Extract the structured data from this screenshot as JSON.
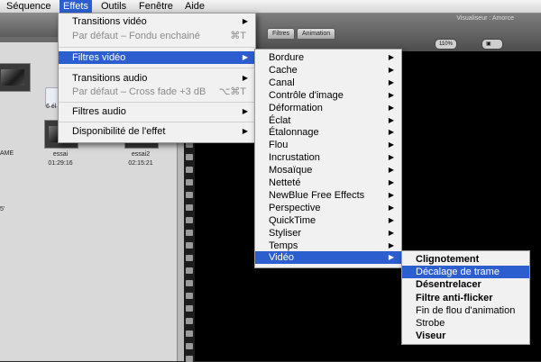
{
  "menubar": {
    "items": [
      "Séquence",
      "Effets",
      "Outils",
      "Fenêtre",
      "Aide"
    ]
  },
  "effects_menu": {
    "items": [
      {
        "label": "Transitions vidéo"
      },
      {
        "label": "Par défaut – Fondu enchainé",
        "shortcut": "⌘T"
      },
      {
        "label": "Filtres vidéo"
      },
      {
        "label": "Transitions audio"
      },
      {
        "label": "Par défaut – Cross fade +3 dB",
        "shortcut": "⌥⌘T"
      },
      {
        "label": "Filtres audio"
      },
      {
        "label": "Disponibilité de l'effet"
      }
    ]
  },
  "video_filters_menu": {
    "items": [
      "Bordure",
      "Cache",
      "Canal",
      "Contrôle d'image",
      "Déformation",
      "Éclat",
      "Étalonnage",
      "Flou",
      "Incrustation",
      "Mosaïque",
      "Netteté",
      "NewBlue Free Effects",
      "Perspective",
      "QuickTime",
      "Styliser",
      "Temps",
      "Vidéo"
    ]
  },
  "video_submenu": {
    "items": [
      "Clignotement",
      "Décalage de trame",
      "Désentrelacer",
      "Filtre anti-flicker",
      "Fin de flou d'animation",
      "Strobe",
      "Viseur"
    ]
  },
  "browser": {
    "clips": [
      {
        "name": "essai",
        "duration": "01:29:16"
      },
      {
        "name": "essai2",
        "duration": "02:15:21"
      }
    ],
    "folder_label": "6 él",
    "side_labels": [
      "AME",
      "5'"
    ]
  },
  "viewer": {
    "title": "Visualiseur : Amorce",
    "tabs": [
      "Filtres",
      "Animation"
    ],
    "zoom": "110%"
  }
}
